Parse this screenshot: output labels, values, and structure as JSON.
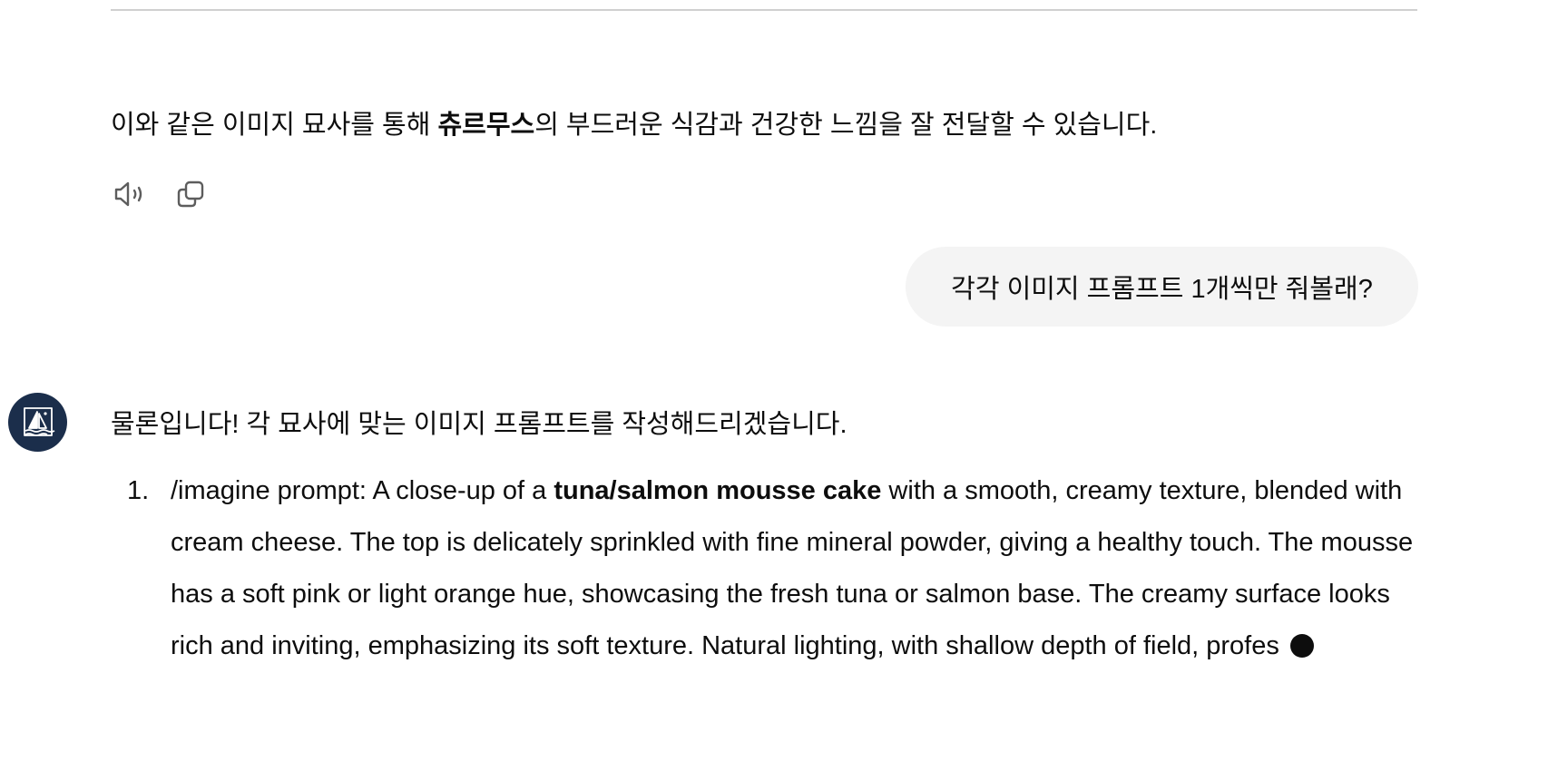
{
  "previous_message": {
    "before": "이와 같은 이미지 묘사를 통해 ",
    "bold": "츄르무스",
    "after": "의 부드러운 식감과 건강한 느낌을 잘 전달할 수 있습니다."
  },
  "actions": {
    "read_aloud_icon": "speaker-icon",
    "copy_icon": "copy-icon"
  },
  "user_message": "각각 이미지 프롬프트 1개씩만 줘볼래?",
  "assistant": {
    "avatar_icon": "sailboat-logo",
    "intro": "물론입니다! 각 묘사에 맞는 이미지 프롬프트를 작성해드리겠습니다.",
    "items": [
      {
        "number": "1.",
        "before": "/imagine prompt: A close-up of a ",
        "bold": "tuna/salmon mousse cake",
        "after": " with a smooth, creamy texture, blended with cream cheese. The top is delicately sprinkled with fine mineral powder, giving a healthy touch. The mousse has a soft pink or light orange hue, showcasing the fresh tuna or salmon base. The creamy surface looks rich and inviting, emphasizing its soft texture. Natural lighting, with shallow depth of field, profes"
      }
    ]
  },
  "colors": {
    "text": "#0d0d0d",
    "bubble": "#f4f4f4",
    "avatar_bg": "#1b2e4b",
    "divider": "#d0d0d0"
  }
}
